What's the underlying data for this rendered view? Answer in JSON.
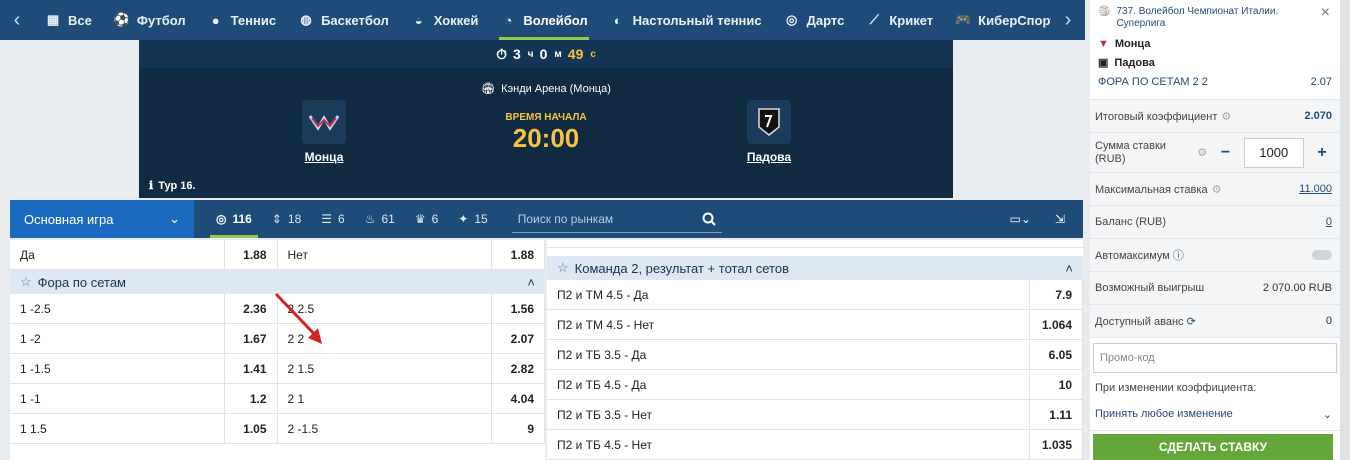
{
  "sport_nav": {
    "items": [
      {
        "label": "Все",
        "icon": "grid-icon"
      },
      {
        "label": "Футбол",
        "icon": "football-icon"
      },
      {
        "label": "Теннис",
        "icon": "tennis-icon"
      },
      {
        "label": "Баскетбол",
        "icon": "basketball-icon"
      },
      {
        "label": "Хоккей",
        "icon": "hockey-icon"
      },
      {
        "label": "Волейбол",
        "icon": "volleyball-icon",
        "active": true
      },
      {
        "label": "Настольный теннис",
        "icon": "table-tennis-icon"
      },
      {
        "label": "Дартс",
        "icon": "darts-icon"
      },
      {
        "label": "Крикет",
        "icon": "cricket-icon"
      },
      {
        "label": "КиберСпорт",
        "icon": "gamepad-icon"
      }
    ]
  },
  "match": {
    "timer": {
      "hours": "3",
      "hours_unit": "ч",
      "minutes": "0",
      "minutes_unit": "м",
      "seconds": "49",
      "seconds_unit": "с"
    },
    "arena": "Кэнди Арена (Монца)",
    "team1": "Монца",
    "team2": "Падова",
    "start_label": "ВРЕМЯ НАЧАЛА",
    "start_time": "20:00",
    "round": "Тур 16."
  },
  "filters": {
    "main_dropdown": "Основная игра",
    "counts": [
      {
        "icon": "target-icon",
        "value": "116"
      },
      {
        "icon": "updown-icon",
        "value": "18"
      },
      {
        "icon": "bars-icon",
        "value": "6"
      },
      {
        "icon": "flame-icon",
        "value": "61"
      },
      {
        "icon": "trophy-icon",
        "value": "6"
      },
      {
        "icon": "wand-icon",
        "value": "15"
      }
    ],
    "search_placeholder": "Поиск по рынкам"
  },
  "left_markets": {
    "top_row": {
      "name1": "Да",
      "odd1": "1.88",
      "name2": "Нет",
      "odd2": "1.88"
    },
    "group_title": "Фора по сетам",
    "rows": [
      {
        "name1": "1 -2.5",
        "odd1": "2.36",
        "name2": "2 2.5",
        "odd2": "1.56"
      },
      {
        "name1": "1 -2",
        "odd1": "1.67",
        "name2": "2 2",
        "odd2": "2.07"
      },
      {
        "name1": "1 -1.5",
        "odd1": "1.41",
        "name2": "2 1.5",
        "odd2": "2.82"
      },
      {
        "name1": "1 -1",
        "odd1": "1.2",
        "name2": "2 1",
        "odd2": "4.04"
      },
      {
        "name1": "1 1.5",
        "odd1": "1.05",
        "name2": "2 -1.5",
        "odd2": "9"
      }
    ]
  },
  "right_markets": {
    "group_title": "Команда 2, результат + тотал сетов",
    "rows": [
      {
        "name": "П2 и ТМ 4.5 - Да",
        "odd": "7.9"
      },
      {
        "name": "П2 и ТМ 4.5 - Нет",
        "odd": "1.064"
      },
      {
        "name": "П2 и ТБ 3.5 - Да",
        "odd": "6.05"
      },
      {
        "name": "П2 и ТБ 4.5 - Да",
        "odd": "10"
      },
      {
        "name": "П2 и ТБ 3.5 - Нет",
        "odd": "1.11"
      },
      {
        "name": "П2 и ТБ 4.5 - Нет",
        "odd": "1.035"
      }
    ]
  },
  "betslip": {
    "event": "737. Волейбол Чемпионат Италии. Суперлига",
    "team1": "Монца",
    "team2": "Падова",
    "market": "ФОРА ПО СЕТАМ 2 2",
    "market_odd": "2.07",
    "total_coef_label": "Итоговый коэффициент",
    "total_coef": "2.070",
    "stake_label": "Сумма ставки (RUB)",
    "stake_value": "1000",
    "max_bet_label": "Максимальная ставка",
    "max_bet": "11.000",
    "balance_label": "Баланс (RUB)",
    "balance": "0",
    "automax_label": "Автомаксимум",
    "win_label": "Возможный выигрыш",
    "win_value": "2 070.00 RUB",
    "advance_label": "Доступный аванс",
    "advance_value": "0",
    "promo_placeholder": "Промо-код",
    "change_label": "При изменении коэффициента:",
    "change_value": "Принять любое изменение",
    "submit": "СДЕЛАТЬ СТАВКУ"
  }
}
